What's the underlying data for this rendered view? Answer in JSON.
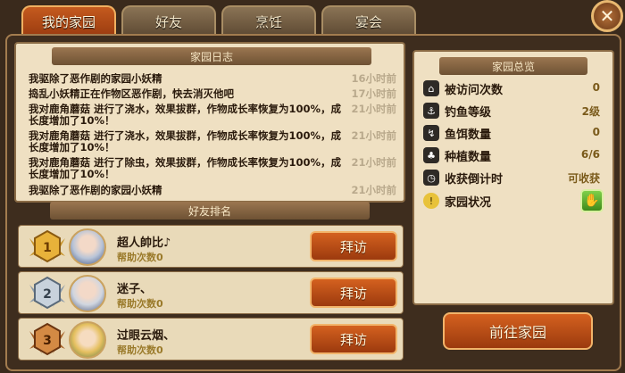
{
  "tabs": [
    {
      "label": "我的家园",
      "active": true
    },
    {
      "label": "好友",
      "active": false
    },
    {
      "label": "烹饪",
      "active": false
    },
    {
      "label": "宴会",
      "active": false
    }
  ],
  "close_label": "✕",
  "log": {
    "title": "家园日志",
    "entries": [
      {
        "text": "我驱除了恶作剧的家园小妖精",
        "time": "16小时前"
      },
      {
        "text": "捣乱小妖精正在作物区恶作剧，快去消灭他吧",
        "time": "17小时前"
      },
      {
        "text": "我对鹿角蘑菇 进行了浇水，效果拔群，作物成长率恢复为100%，成长度增加了10%！",
        "time": "21小时前"
      },
      {
        "text": "我对鹿角蘑菇 进行了浇水，效果拔群，作物成长率恢复为100%，成长度增加了10%！",
        "time": "21小时前"
      },
      {
        "text": "我对鹿角蘑菇 进行了除虫，效果拔群，作物成长率恢复为100%，成长度增加了10%！",
        "time": "21小时前"
      },
      {
        "text": "我驱除了恶作剧的家园小妖精",
        "time": "21小时前"
      }
    ]
  },
  "ranking": {
    "title": "好友排名",
    "friends": [
      {
        "rank": "1",
        "name": "超人帥比♪",
        "help": "帮助次数0",
        "visit": "拜访"
      },
      {
        "rank": "2",
        "name": "迷子、",
        "help": "帮助次数0",
        "visit": "拜访"
      },
      {
        "rank": "3",
        "name": "过眼云烟、",
        "help": "帮助次数0",
        "visit": "拜访"
      }
    ]
  },
  "overview": {
    "title": "家园总览",
    "rows": [
      {
        "icon": "home-icon",
        "glyph": "⌂",
        "label": "被访问次数",
        "value": "0"
      },
      {
        "icon": "fishing-icon",
        "glyph": "⚓",
        "label": "钓鱼等级",
        "value": "2级"
      },
      {
        "icon": "bait-icon",
        "glyph": "↯",
        "label": "鱼饵数量",
        "value": "0"
      },
      {
        "icon": "sprout-icon",
        "glyph": "♣",
        "label": "种植数量",
        "value": "6/6"
      },
      {
        "icon": "timer-icon",
        "glyph": "◷",
        "label": "收获倒计时",
        "value": "可收获"
      },
      {
        "icon": "alert-icon",
        "glyph": "!",
        "label": "家园状况",
        "value": ""
      }
    ]
  },
  "goto_button": "前往家园",
  "colors": {
    "accent": "#c45a1e",
    "panel": "#efe0c2",
    "frame": "#3a2a1c"
  }
}
